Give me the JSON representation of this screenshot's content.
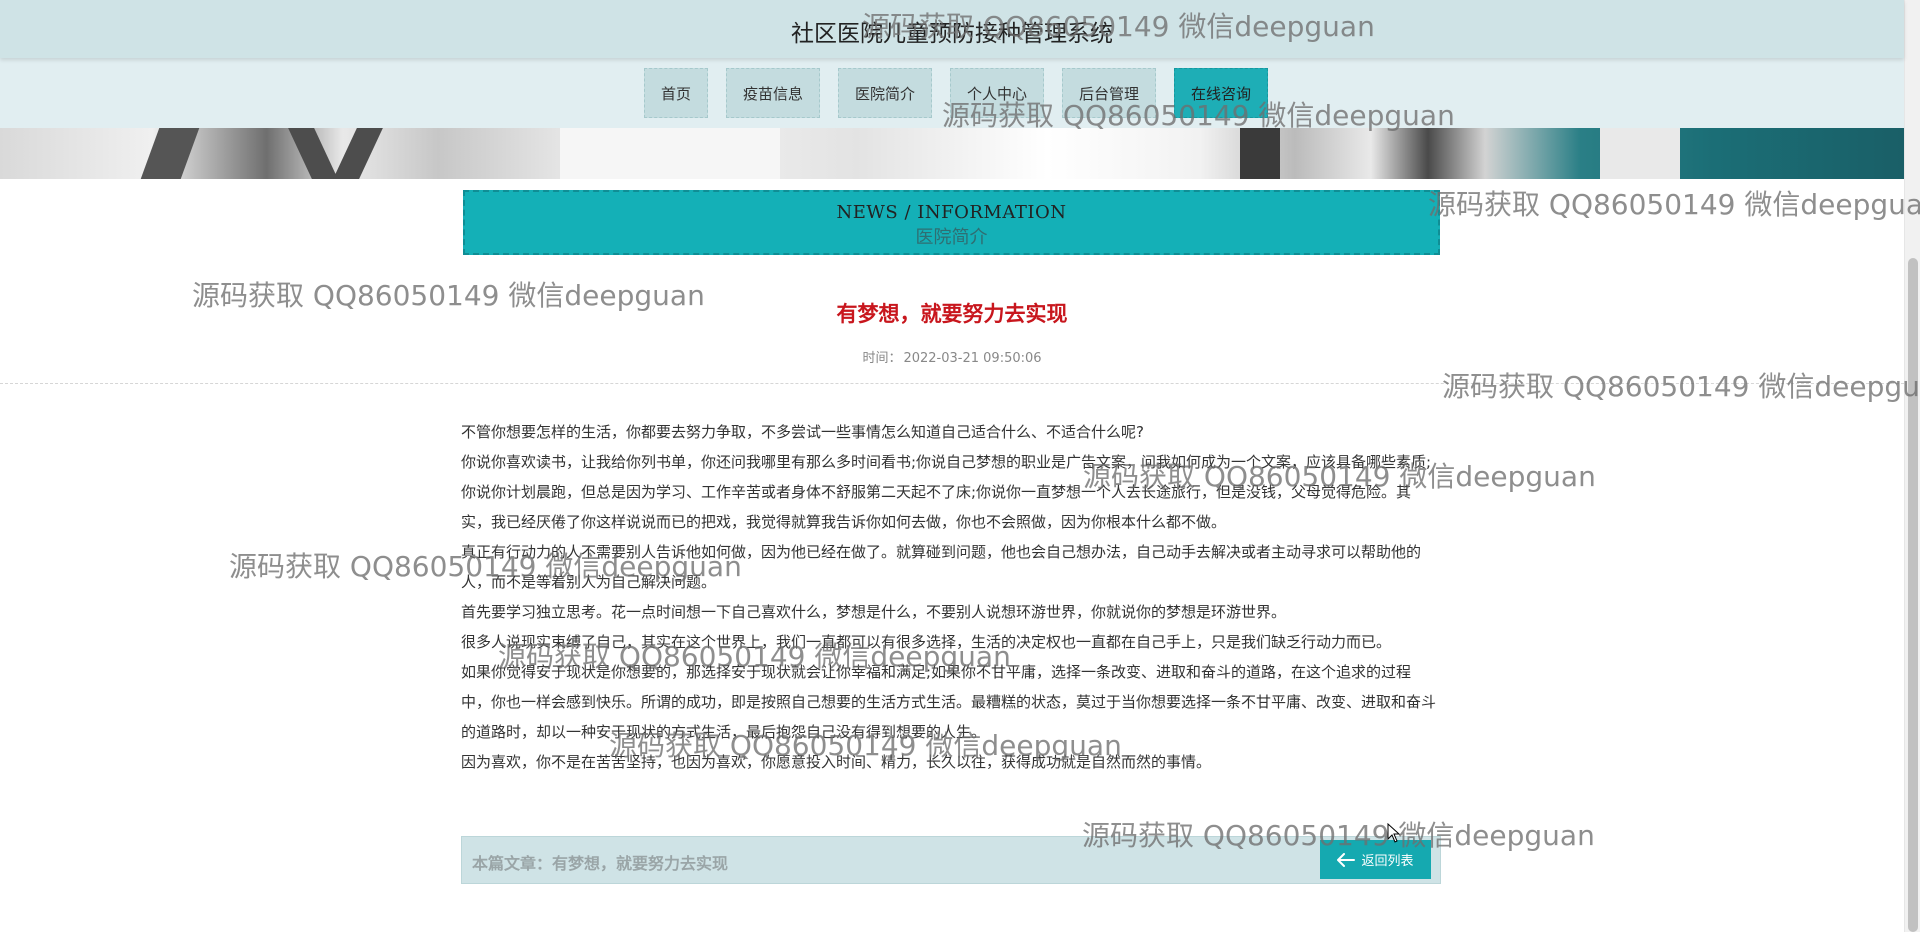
{
  "header": {
    "site_title": "社区医院儿童预防接种管理系统"
  },
  "nav": {
    "items": [
      {
        "label": "首页",
        "active": false
      },
      {
        "label": "疫苗信息",
        "active": false
      },
      {
        "label": "医院简介",
        "active": false
      },
      {
        "label": "个人中心",
        "active": false
      },
      {
        "label": "后台管理",
        "active": false
      },
      {
        "label": "在线咨询",
        "active": true
      }
    ]
  },
  "section": {
    "title_en": "NEWS / INFORMATION",
    "title_cn": "医院简介"
  },
  "article": {
    "title": "有梦想，就要努力去实现",
    "time_label": "时间：",
    "time_value": "2022-03-21 09:50:06",
    "paragraphs": [
      "不管你想要怎样的生活，你都要去努力争取，不多尝试一些事情怎么知道自己适合什么、不适合什么呢?",
      "你说你喜欢读书，让我给你列书单，你还问我哪里有那么多时间看书;你说自己梦想的职业是广告文案，问我如何成为一个文案，应该具备哪些素质;你说你计划晨跑，但总是因为学习、工作辛苦或者身体不舒服第二天起不了床;你说你一直梦想一个人去长途旅行，但是没钱，父母觉得危险。其实，我已经厌倦了你这样说说而已的把戏，我觉得就算我告诉你如何去做，你也不会照做，因为你根本什么都不做。",
      "真正有行动力的人不需要别人告诉他如何做，因为他已经在做了。就算碰到问题，他也会自己想办法，自己动手去解决或者主动寻求可以帮助他的人，而不是等着别人为自己解决问题。",
      "首先要学习独立思考。花一点时间想一下自己喜欢什么，梦想是什么，不要别人说想环游世界，你就说你的梦想是环游世界。",
      "很多人说现实束缚了自己，其实在这个世界上，我们一直都可以有很多选择，生活的决定权也一直都在自己手上，只是我们缺乏行动力而已。",
      "如果你觉得安于现状是你想要的，那选择安于现状就会让你幸福和满足;如果你不甘平庸，选择一条改变、进取和奋斗的道路，在这个追求的过程中，你也一样会感到快乐。所谓的成功，即是按照自己想要的生活方式生活。最糟糕的状态，莫过于当你想要选择一条不甘平庸、改变、进取和奋斗的道路时，却以一种安于现状的方式生活，最后抱怨自己没有得到想要的人生。",
      "因为喜欢，你不是在苦苦坚持，也因为喜欢，你愿意投入时间、精力，长久以往，获得成功就是自然而然的事情。"
    ]
  },
  "footer": {
    "current_label": "本篇文章：",
    "current_title": "有梦想，就要努力去实现",
    "back_label": "返回列表"
  },
  "watermark": {
    "text": "源码获取 QQ86050149 微信deepguan"
  },
  "colors": {
    "accent": "#14b0b7",
    "title_red": "#c8161d",
    "header_bg": "#cfe3e6",
    "nav_bg": "#e1eef1"
  }
}
